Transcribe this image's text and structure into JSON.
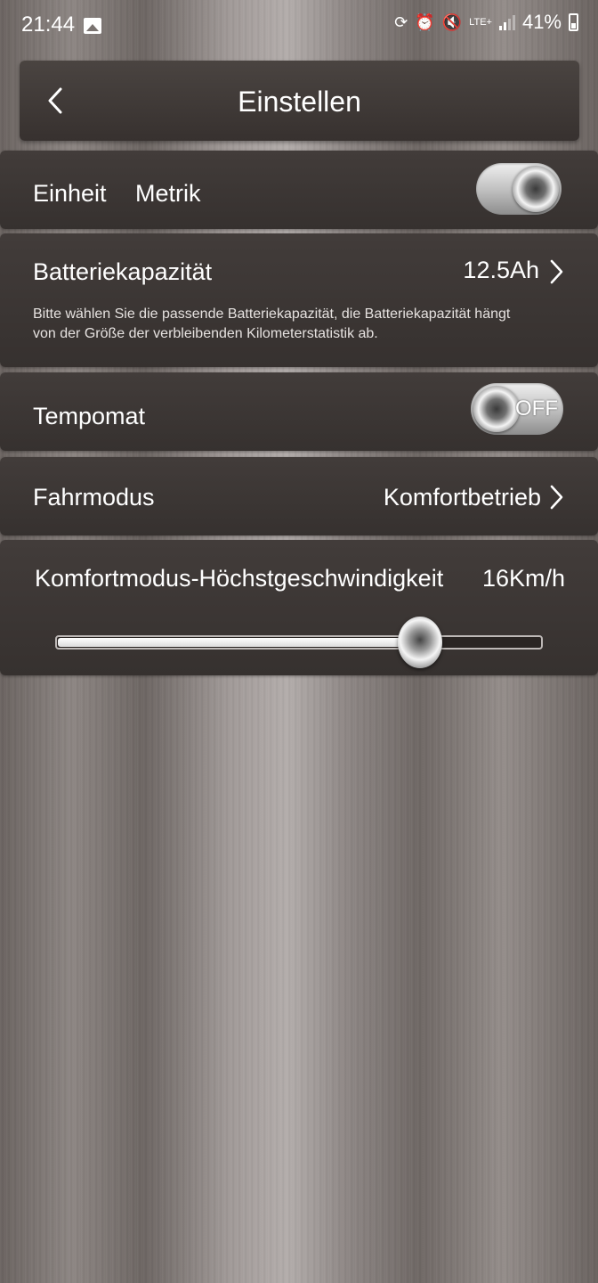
{
  "status": {
    "time": "21:44",
    "battery": "41%",
    "network": "LTE+",
    "icons": [
      "gallery-icon",
      "sync-icon",
      "alarm-icon",
      "mute-icon",
      "signal-icon",
      "battery-icon"
    ]
  },
  "header": {
    "title": "Einstellen",
    "back_icon": "chevron-left-icon"
  },
  "settings": {
    "unit": {
      "label": "Einheit",
      "value": "Metrik",
      "toggle_on": true
    },
    "battery": {
      "label": "Batteriekapazität",
      "value": "12.5Ah",
      "hint": "Bitte wählen Sie die passende Batteriekapazität, die Batteriekapazität hängt von der Größe der verbleibenden Kilometerstatistik ab."
    },
    "cruise": {
      "label": "Tempomat",
      "toggle_text": "OFF",
      "toggle_on": false
    },
    "mode": {
      "label": "Fahrmodus",
      "value": "Komfortbetrieb"
    },
    "max_speed": {
      "label": "Komfortmodus-Höchstgeschwindigkeit",
      "value": "16Km/h",
      "slider_fraction": 0.75
    }
  },
  "colors": {
    "panel": "#3b3533",
    "text": "#ffffff"
  }
}
